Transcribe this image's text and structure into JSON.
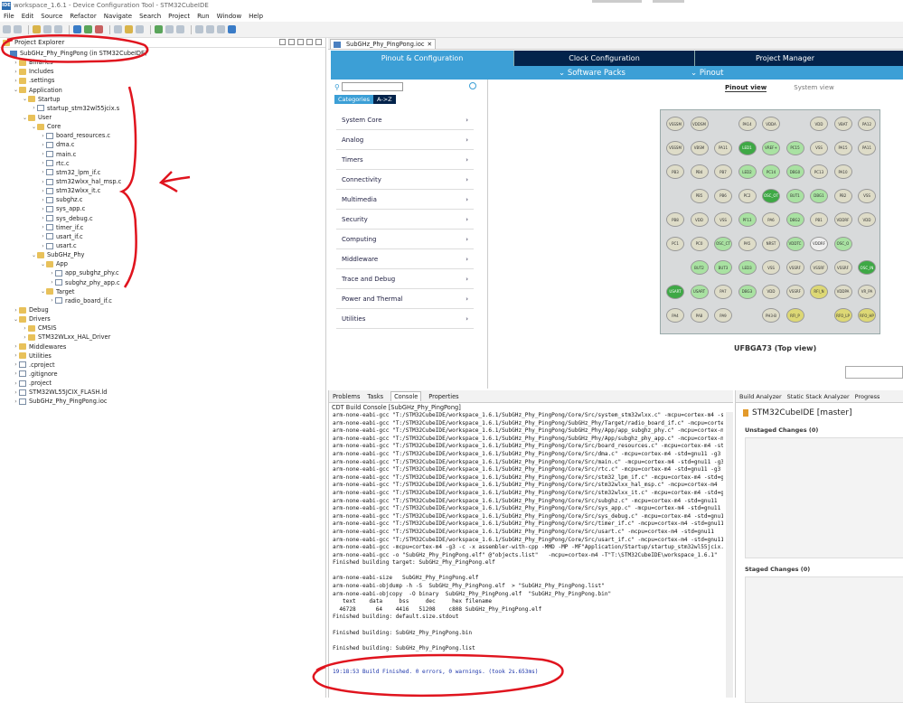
{
  "window": {
    "title": "workspace_1.6.1 - Device Configuration Tool - STM32CubeIDE",
    "logo": "IDE"
  },
  "menu": [
    "File",
    "Edit",
    "Source",
    "Refactor",
    "Navigate",
    "Search",
    "Project",
    "Run",
    "Window",
    "Help"
  ],
  "project_explorer": {
    "tab_label": "Project Explorer",
    "tree": [
      {
        "level": 0,
        "label": "SubGHz_Phy_PingPong (in STM32CubeIDE)",
        "type": "proj",
        "expanded": true
      },
      {
        "level": 1,
        "label": "Binaries",
        "type": "folder",
        "expanded": false
      },
      {
        "level": 1,
        "label": "Includes",
        "type": "folder",
        "expanded": false
      },
      {
        "level": 1,
        "label": ".settings",
        "type": "folder",
        "expanded": false
      },
      {
        "level": 1,
        "label": "Application",
        "type": "folder",
        "expanded": true
      },
      {
        "level": 2,
        "label": "Startup",
        "type": "folder",
        "expanded": true
      },
      {
        "level": 3,
        "label": "startup_stm32wl55jcix.s",
        "type": "file",
        "expanded": false
      },
      {
        "level": 2,
        "label": "User",
        "type": "folder",
        "expanded": true
      },
      {
        "level": 3,
        "label": "Core",
        "type": "folder",
        "expanded": true
      },
      {
        "level": 4,
        "label": "board_resources.c",
        "type": "file",
        "expanded": false
      },
      {
        "level": 4,
        "label": "dma.c",
        "type": "file",
        "expanded": false
      },
      {
        "level": 4,
        "label": "main.c",
        "type": "file",
        "expanded": false
      },
      {
        "level": 4,
        "label": "rtc.c",
        "type": "file",
        "expanded": false
      },
      {
        "level": 4,
        "label": "stm32_lpm_if.c",
        "type": "file",
        "expanded": false
      },
      {
        "level": 4,
        "label": "stm32wlxx_hal_msp.c",
        "type": "file",
        "expanded": false
      },
      {
        "level": 4,
        "label": "stm32wlxx_it.c",
        "type": "file",
        "expanded": false
      },
      {
        "level": 4,
        "label": "subghz.c",
        "type": "file",
        "expanded": false
      },
      {
        "level": 4,
        "label": "sys_app.c",
        "type": "file",
        "expanded": false
      },
      {
        "level": 4,
        "label": "sys_debug.c",
        "type": "file",
        "expanded": false
      },
      {
        "level": 4,
        "label": "timer_if.c",
        "type": "file",
        "expanded": false
      },
      {
        "level": 4,
        "label": "usart_if.c",
        "type": "file",
        "expanded": false
      },
      {
        "level": 4,
        "label": "usart.c",
        "type": "file",
        "expanded": false
      },
      {
        "level": 3,
        "label": "SubGHz_Phy",
        "type": "folder",
        "expanded": true
      },
      {
        "level": 4,
        "label": "App",
        "type": "folder",
        "expanded": true
      },
      {
        "level": 5,
        "label": "app_subghz_phy.c",
        "type": "file",
        "expanded": false
      },
      {
        "level": 5,
        "label": "subghz_phy_app.c",
        "type": "file",
        "expanded": false
      },
      {
        "level": 4,
        "label": "Target",
        "type": "folder",
        "expanded": true
      },
      {
        "level": 5,
        "label": "radio_board_if.c",
        "type": "file",
        "expanded": false
      },
      {
        "level": 1,
        "label": "Debug",
        "type": "folder",
        "expanded": false
      },
      {
        "level": 1,
        "label": "Drivers",
        "type": "folder",
        "expanded": true
      },
      {
        "level": 2,
        "label": "CMSIS",
        "type": "folder",
        "expanded": false
      },
      {
        "level": 2,
        "label": "STM32WLxx_HAL_Driver",
        "type": "folder",
        "expanded": false
      },
      {
        "level": 1,
        "label": "Middlewares",
        "type": "folder",
        "expanded": false
      },
      {
        "level": 1,
        "label": "Utilities",
        "type": "folder",
        "expanded": false
      },
      {
        "level": 1,
        "label": ".cproject",
        "type": "file",
        "expanded": false
      },
      {
        "level": 1,
        "label": ".gitignore",
        "type": "file",
        "expanded": false
      },
      {
        "level": 1,
        "label": ".project",
        "type": "file",
        "expanded": false
      },
      {
        "level": 1,
        "label": "STM32WL55JCIX_FLASH.ld",
        "type": "file",
        "expanded": false
      },
      {
        "level": 1,
        "label": "SubGHz_Phy_PingPong.ioc",
        "type": "file",
        "expanded": false
      }
    ]
  },
  "editor": {
    "tab_label": "SubGHz_Phy_PingPong.ioc",
    "nav": [
      "Pinout & Configuration",
      "Clock Configuration",
      "Project Manager"
    ],
    "subnav": {
      "software_packs": "Software Packs",
      "pinout": "Pinout"
    },
    "category_buttons": [
      "Categories",
      "A->Z"
    ],
    "categories": [
      "System Core",
      "Analog",
      "Timers",
      "Connectivity",
      "Multimedia",
      "Security",
      "Computing",
      "Middleware",
      "Trace and Debug",
      "Power and Thermal",
      "Utilities"
    ],
    "views": {
      "pinout": "Pinout view",
      "system": "System view"
    },
    "chip_label": "UFBGA73 (Top view)",
    "pins": [
      [
        "VSSSM",
        "VDDSM",
        "",
        "PA14",
        "VDDA",
        "",
        "VDD",
        "VBAT",
        "PA12"
      ],
      [
        "VSSSM",
        "VBSM",
        "PA11",
        "LED1",
        "VREF+",
        "PC15",
        "VSS",
        "PA15",
        "PA11"
      ],
      [
        "PB3",
        "PB4",
        "PB7",
        "LED2",
        "PC14",
        "DBG0",
        "PC13",
        "PA10",
        ""
      ],
      [
        "",
        "PB5",
        "PB6",
        "PC2",
        "OSC_OT",
        "BUT1",
        "DBG1",
        "PB2",
        "VSS"
      ],
      [
        "PB8",
        "VDD",
        "VSS",
        "PF13",
        "PA6",
        "DBG2",
        "PB1",
        "VDDRF",
        "VDD"
      ],
      [
        "PC1",
        "PC0",
        "OSC_CT",
        "PA5",
        "NRST",
        "VDDTC",
        "VDDRF",
        "OSC_O",
        ""
      ],
      [
        "",
        "BUT2",
        "BUT3",
        "LED3",
        "VSS",
        "VSSRF",
        "VSSRF",
        "VSSRF",
        "OSC_IN"
      ],
      [
        "USART",
        "USART",
        "PA7",
        "DBG3",
        "VDD",
        "VSSRF",
        "RFI_N",
        "VDDPA",
        "VR_PA"
      ],
      [
        "PA4",
        "PA8",
        "PA9",
        "",
        "PH3-B",
        "RFI_P",
        "",
        "RFO_LP",
        "RFO_HP"
      ]
    ],
    "pin_colors": [
      [
        "k",
        "k",
        "",
        "k",
        "k",
        "",
        "k",
        "k",
        "k"
      ],
      [
        "k",
        "k",
        "k",
        "g",
        "l",
        "l",
        "k",
        "k",
        "k"
      ],
      [
        "k",
        "k",
        "k",
        "l",
        "l",
        "l",
        "k",
        "k",
        ""
      ],
      [
        "",
        "k",
        "k",
        "k",
        "g",
        "l",
        "l",
        "k",
        "k"
      ],
      [
        "k",
        "k",
        "k",
        "l",
        "k",
        "l",
        "k",
        "k",
        "k"
      ],
      [
        "k",
        "k",
        "l",
        "k",
        "k",
        "l",
        "e",
        "l",
        ""
      ],
      [
        "",
        "l",
        "l",
        "l",
        "k",
        "k",
        "k",
        "k",
        "g"
      ],
      [
        "g",
        "l",
        "k",
        "l",
        "k",
        "k",
        "y",
        "k",
        "k"
      ],
      [
        "k",
        "k",
        "k",
        "",
        "k",
        "y",
        "",
        "y",
        "y"
      ]
    ]
  },
  "console": {
    "tabs": [
      "Problems",
      "Tasks",
      "Console",
      "Properties"
    ],
    "title": "CDT Build Console [SubGHz_Phy_PingPong]",
    "lines": [
      "arm-none-eabi-gcc \"T:/STM32CubeIDE/workspace_1.6.1/SubGHz_Phy_PingPong/Core/Src/system_stm32wlxx.c\" -mcpu=cortex-m4 -std=gnu11",
      "arm-none-eabi-gcc \"T:/STM32CubeIDE/workspace_1.6.1/SubGHz_Phy_PingPong/SubGHz_Phy/Target/radio_board_if.c\" -mcpu=cortex-m4",
      "arm-none-eabi-gcc \"T:/STM32CubeIDE/workspace_1.6.1/SubGHz_Phy_PingPong/SubGHz_Phy/App/app_subghz_phy.c\" -mcpu=cortex-m4",
      "arm-none-eabi-gcc \"T:/STM32CubeIDE/workspace_1.6.1/SubGHz_Phy_PingPong/SubGHz_Phy/App/subghz_phy_app.c\" -mcpu=cortex-m4",
      "arm-none-eabi-gcc \"T:/STM32CubeIDE/workspace_1.6.1/SubGHz_Phy_PingPong/Core/Src/board_resources.c\" -mcpu=cortex-m4 -std=gnu11",
      "arm-none-eabi-gcc \"T:/STM32CubeIDE/workspace_1.6.1/SubGHz_Phy_PingPong/Core/Src/dma.c\" -mcpu=cortex-m4 -std=gnu11 -g3",
      "arm-none-eabi-gcc \"T:/STM32CubeIDE/workspace_1.6.1/SubGHz_Phy_PingPong/Core/Src/main.c\" -mcpu=cortex-m4 -std=gnu11 -g3",
      "arm-none-eabi-gcc \"T:/STM32CubeIDE/workspace_1.6.1/SubGHz_Phy_PingPong/Core/Src/rtc.c\" -mcpu=cortex-m4 -std=gnu11 -g3",
      "arm-none-eabi-gcc \"T:/STM32CubeIDE/workspace_1.6.1/SubGHz_Phy_PingPong/Core/Src/stm32_lpm_if.c\" -mcpu=cortex-m4 -std=gnu11",
      "arm-none-eabi-gcc \"T:/STM32CubeIDE/workspace_1.6.1/SubGHz_Phy_PingPong/Core/Src/stm32wlxx_hal_msp.c\" -mcpu=cortex-m4",
      "arm-none-eabi-gcc \"T:/STM32CubeIDE/workspace_1.6.1/SubGHz_Phy_PingPong/Core/Src/stm32wlxx_it.c\" -mcpu=cortex-m4 -std=gnu11",
      "arm-none-eabi-gcc \"T:/STM32CubeIDE/workspace_1.6.1/SubGHz_Phy_PingPong/Core/Src/subghz.c\" -mcpu=cortex-m4 -std=gnu11",
      "arm-none-eabi-gcc \"T:/STM32CubeIDE/workspace_1.6.1/SubGHz_Phy_PingPong/Core/Src/sys_app.c\" -mcpu=cortex-m4 -std=gnu11",
      "arm-none-eabi-gcc \"T:/STM32CubeIDE/workspace_1.6.1/SubGHz_Phy_PingPong/Core/Src/sys_debug.c\" -mcpu=cortex-m4 -std=gnu11",
      "arm-none-eabi-gcc \"T:/STM32CubeIDE/workspace_1.6.1/SubGHz_Phy_PingPong/Core/Src/timer_if.c\" -mcpu=cortex-m4 -std=gnu11",
      "arm-none-eabi-gcc \"T:/STM32CubeIDE/workspace_1.6.1/SubGHz_Phy_PingPong/Core/Src/usart.c\" -mcpu=cortex-m4 -std=gnu11",
      "arm-none-eabi-gcc \"T:/STM32CubeIDE/workspace_1.6.1/SubGHz_Phy_PingPong/Core/Src/usart_if.c\" -mcpu=cortex-m4 -std=gnu11",
      "arm-none-eabi-gcc -mcpu=cortex-m4 -g3 -c -x assembler-with-cpp -MMD -MP -MF\"Application/Startup/startup_stm32wl55jcix.d\"",
      "arm-none-eabi-gcc -o \"SubGHz_Phy_PingPong.elf\" @\"objects.list\"   -mcpu=cortex-m4 -T\"T:\\STM32CubeIDE\\workspace_1.6.1\"",
      "Finished building target: SubGHz_Phy_PingPong.elf",
      " ",
      "arm-none-eabi-size   SubGHz_Phy_PingPong.elf",
      "arm-none-eabi-objdump -h -S  SubGHz_Phy_PingPong.elf  > \"SubGHz_Phy_PingPong.list\"",
      "arm-none-eabi-objcopy  -O binary  SubGHz_Phy_PingPong.elf  \"SubGHz_Phy_PingPong.bin\"",
      "   text    data     bss     dec     hex filename",
      "  46728      64    4416   51208    c808 SubGHz_Phy_PingPong.elf",
      "Finished building: default.size.stdout",
      " ",
      "Finished building: SubGHz_Phy_PingPong.bin",
      " ",
      "Finished building: SubGHz_Phy_PingPong.list",
      " ",
      " "
    ],
    "done": "19:18:53 Build Finished. 0 errors, 0 warnings. (took 2s.653ms)"
  },
  "git": {
    "tabs": [
      "Build Analyzer",
      "Static Stack Analyzer",
      "Progress"
    ],
    "repo": "STM32CubeIDE [master]",
    "unstaged": "Unstaged Changes (0)",
    "staged": "Staged Changes (0)"
  },
  "colors": {
    "accent": "#3c9fd6",
    "nav_dark": "#03234b",
    "annotation": "#e0141e"
  }
}
